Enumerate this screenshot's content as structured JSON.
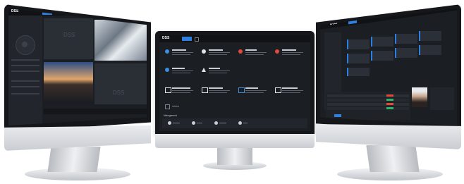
{
  "left_monitor": {
    "logo": "DSS",
    "watermark": "DSS",
    "watermark_2": "DSS"
  },
  "center_monitor": {
    "logo": "DSS",
    "section_label": "Management",
    "tiles": [
      {
        "icon": "monitor-icon",
        "color": "#3b8fe0"
      },
      {
        "icon": "playback-icon",
        "color": "#e0e3e8"
      },
      {
        "icon": "alarm-icon",
        "color": "#e04a3b"
      },
      {
        "icon": "lock-icon",
        "color": "#e04a3b"
      },
      {
        "icon": "video-wall-icon",
        "color": "#3b8fe0"
      },
      {
        "icon": "map-icon",
        "color": "#e0e3e8"
      },
      {
        "icon": "people-icon",
        "color": "#3b8fe0"
      },
      {
        "icon": "access-icon",
        "color": "#e0e3e8"
      },
      {
        "icon": "vehicle-icon",
        "color": "#3b8fe0"
      },
      {
        "icon": "visitor-icon",
        "color": "#e0e3e8"
      }
    ]
  },
  "right_monitor": {
    "logo": "DSS"
  },
  "colors": {
    "accent": "#2f7fe0",
    "alert": "#e04a3b",
    "ok": "#2fb36a"
  }
}
